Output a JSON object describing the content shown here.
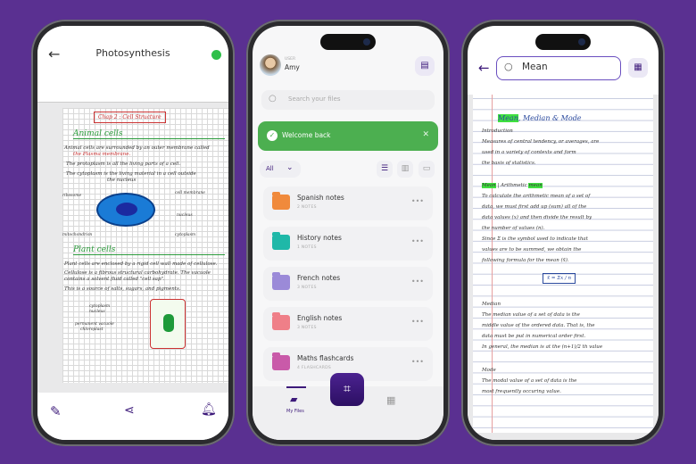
{
  "left": {
    "title": "Photosynthesis",
    "status_color": "#2fbf4a",
    "notes": {
      "chapter": "Chap 2 : Cell Structure",
      "h1": "Animal cells",
      "l1": "Animal cells are surrounded by an outer membrane called",
      "l1b": "the Plasma membrane.",
      "l2": "The protoplasm is all the living parts of a cell.",
      "l3": "The cytoplasm is the living material in a cell outside",
      "l3b": "the nucleus",
      "labels": [
        "ribosome",
        "cell membrane",
        "nucleus",
        "mitochondrion",
        "cytoplasm"
      ],
      "h2": "Plant cells",
      "p1": "Plant cells are enclosed by a rigid cell wall made of cellulose.",
      "p2": "Cellulose is a fibrous structural carbohydrate. The vacuole",
      "p2b": "contains a solvent fluid called \"cell sap\".",
      "p3": "This is a source of salts, sugars, and pigments.",
      "plabels": [
        "cytoplasm",
        "nucleus",
        "permanent vacuole",
        "chloroplast"
      ]
    },
    "toolbar": [
      "pencil",
      "share",
      "bell"
    ]
  },
  "middle": {
    "user_label": "USER",
    "user_name": "Amy",
    "search_placeholder": "Search your files",
    "banner": "Welcome back",
    "banner_color": "#4caf50",
    "filter": "All",
    "files": [
      {
        "name": "Spanish notes",
        "count": "2 NOTES",
        "color": "#f08a3c"
      },
      {
        "name": "History notes",
        "count": "1 NOTES",
        "color": "#1fb8a8"
      },
      {
        "name": "French notes",
        "count": "3 NOTES",
        "color": "#9b8ad8"
      },
      {
        "name": "English notes",
        "count": "3 NOTES",
        "color": "#ef7f88"
      },
      {
        "name": "Maths flashcards",
        "count": "4 FLASHCARDS",
        "color": "#c95aa9"
      }
    ],
    "nav": {
      "my_files": "My Files"
    },
    "accent": "#3d1a7a"
  },
  "right": {
    "search_value": "Mean",
    "notes": {
      "title_a": "Mean",
      "title_b": ", Median & Mode",
      "intro_h": "Introduction",
      "intro": [
        "Measures of central tendency, or averages, are",
        "used in a variety of contexts and form",
        "the basis of statistics."
      ],
      "mean_h_a": "Mean",
      "mean_h_b": " | Arithmetic ",
      "mean_h_c": "mean",
      "mean": [
        "To calculate the arithmetic mean of a set of",
        "data, we must first add up (sum) all of the",
        "data values (x) and then divide the result by",
        "the number of values (n).",
        "Since Σ is the symbol used to indicate that",
        "values are to be summed, we obtain the",
        "following formula for the mean (x̄)."
      ],
      "formula": "x̄ = Σx / n",
      "median_h": "Median",
      "median": [
        "The median value of a set of data is the",
        "middle value of the ordered data. That is, the",
        "data must be put in numerical order first.",
        "In general, the median is at the (n+1)/2 th value"
      ],
      "mode_h": "Mode",
      "mode": [
        "The modal value of a set of data is the",
        "most frequently occuring value."
      ]
    }
  }
}
